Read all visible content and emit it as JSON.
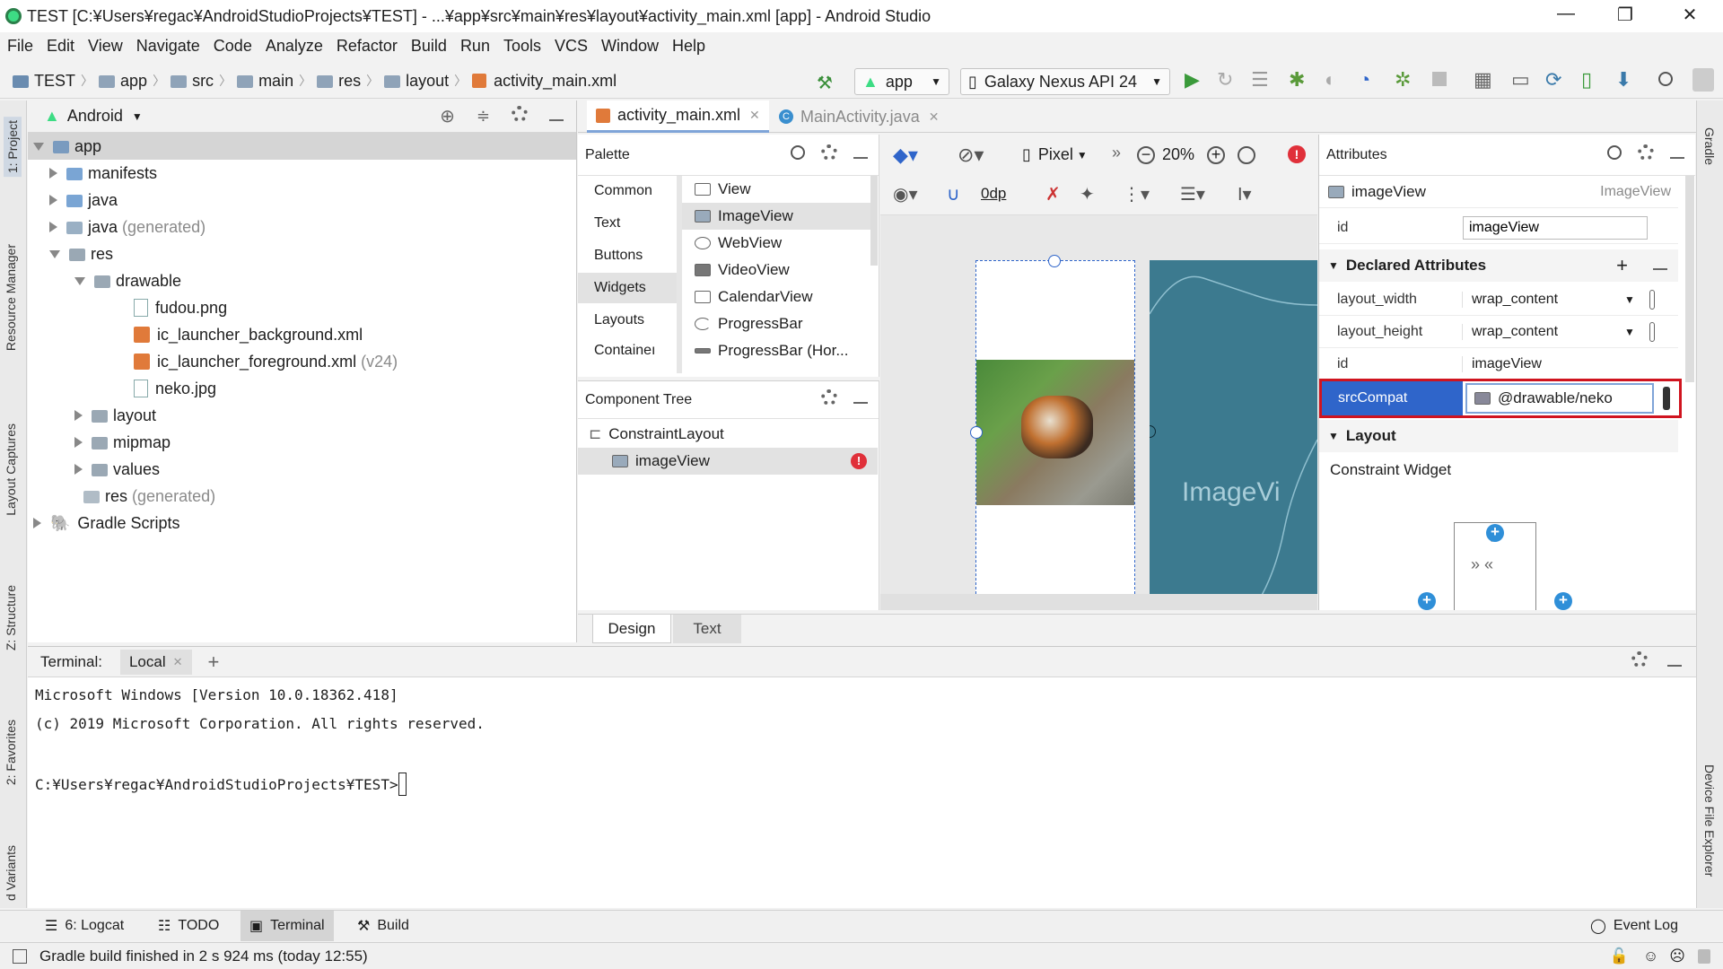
{
  "window": {
    "title": "TEST [C:¥Users¥regac¥AndroidStudioProjects¥TEST] - ...¥app¥src¥main¥res¥layout¥activity_main.xml [app] - Android Studio"
  },
  "menu": [
    "File",
    "Edit",
    "View",
    "Navigate",
    "Code",
    "Analyze",
    "Refactor",
    "Build",
    "Run",
    "Tools",
    "VCS",
    "Window",
    "Help"
  ],
  "breadcrumb": [
    "TEST",
    "app",
    "src",
    "main",
    "res",
    "layout",
    "activity_main.xml"
  ],
  "toolbar": {
    "config": "app",
    "device": "Galaxy Nexus API 24"
  },
  "project": {
    "view": "Android",
    "tree": [
      {
        "label": "app",
        "suffix": ""
      },
      {
        "label": "manifests",
        "suffix": ""
      },
      {
        "label": "java",
        "suffix": ""
      },
      {
        "label": "java",
        "suffix": "(generated)"
      },
      {
        "label": "res",
        "suffix": ""
      },
      {
        "label": "drawable",
        "suffix": ""
      },
      {
        "label": "fudou.png",
        "suffix": ""
      },
      {
        "label": "ic_launcher_background.xml",
        "suffix": ""
      },
      {
        "label": "ic_launcher_foreground.xml",
        "suffix": "(v24)"
      },
      {
        "label": "neko.jpg",
        "suffix": ""
      },
      {
        "label": "layout",
        "suffix": ""
      },
      {
        "label": "mipmap",
        "suffix": ""
      },
      {
        "label": "values",
        "suffix": ""
      },
      {
        "label": "res",
        "suffix": "(generated)"
      },
      {
        "label": "Gradle Scripts",
        "suffix": ""
      }
    ]
  },
  "left_stripe": [
    "1: Project",
    "Resource Manager",
    "Layout Captures",
    "Z: Structure",
    "2: Favorites",
    "d Variants"
  ],
  "right_stripe": [
    "Gradle",
    "Device File Explorer"
  ],
  "editor_tabs": [
    "activity_main.xml",
    "MainActivity.java"
  ],
  "palette": {
    "title": "Palette",
    "categories": [
      "Common",
      "Text",
      "Buttons",
      "Widgets",
      "Layouts",
      "Containeı"
    ],
    "items": [
      "View",
      "ImageView",
      "WebView",
      "VideoView",
      "CalendarView",
      "ProgressBar",
      "ProgressBar (Hor..."
    ]
  },
  "component_tree": {
    "title": "Component Tree",
    "root": "ConstraintLayout",
    "child": "imageView"
  },
  "design_toolbar": {
    "device": "Pixel",
    "zoom": "20%",
    "margin": "0dp",
    "blueprint_text": "ImageVi"
  },
  "attributes": {
    "title": "Attributes",
    "component": "imageView",
    "component_type": "ImageView",
    "id_label": "id",
    "id_value": "imageView",
    "declared_title": "Declared Attributes",
    "rows": [
      {
        "key": "layout_width",
        "value": "wrap_content"
      },
      {
        "key": "layout_height",
        "value": "wrap_content"
      },
      {
        "key": "id",
        "value": "imageView"
      }
    ],
    "src_key": "srcCompat",
    "src_value": "@drawable/neko",
    "layout_title": "Layout",
    "constraint_label": "Constraint Widget"
  },
  "design_tabs": [
    "Design",
    "Text"
  ],
  "terminal": {
    "label": "Terminal:",
    "tab": "Local",
    "lines": [
      "Microsoft Windows [Version 10.0.18362.418]",
      "(c) 2019 Microsoft Corporation. All rights reserved.",
      "",
      "C:¥Users¥regac¥AndroidStudioProjects¥TEST>"
    ]
  },
  "bottom_tools": [
    "6: Logcat",
    "TODO",
    "Terminal",
    "Build"
  ],
  "event_log": "Event Log",
  "status": "Gradle build finished in 2 s 924 ms (today 12:55)",
  "colors": {
    "accent": "#2f65ca",
    "highlight": "#d0141f",
    "blueprint": "#3c7a8f",
    "error": "#e0303a"
  }
}
